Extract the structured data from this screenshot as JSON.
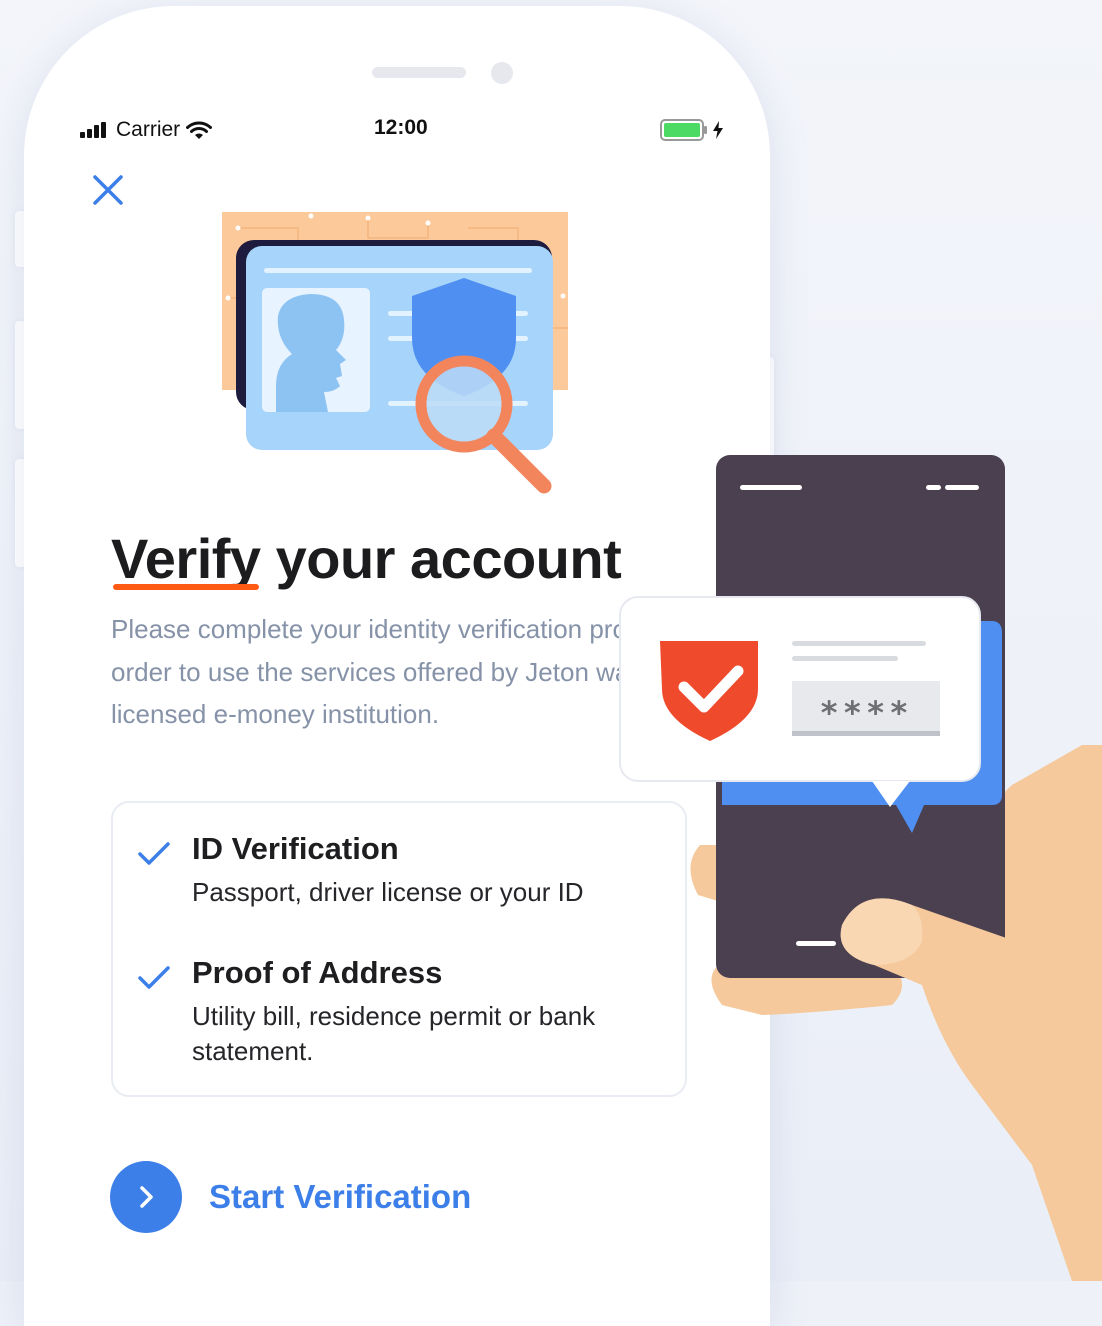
{
  "status_bar": {
    "carrier": "Carrier",
    "time": "12:00"
  },
  "illustration": {
    "pin_masked": "****"
  },
  "content": {
    "title_underlined": "Verify",
    "title_rest": " your account",
    "description": "Please complete your identity verification process in order to use the services offered by Jeton wallet, a licensed e-money institution.",
    "requirements": [
      {
        "title": "ID Verification",
        "subtitle": "Passport, driver license or your ID"
      },
      {
        "title": "Proof of Address",
        "subtitle": "Utility bill, residence permit or bank statement."
      }
    ],
    "start_button": "Start Verification"
  },
  "colors": {
    "accent_blue": "#3d7fe8",
    "underline_orange": "#ff5a14",
    "shield_red": "#f04a2c",
    "phone_dark": "#4a4050",
    "battery_green": "#4cd964"
  }
}
